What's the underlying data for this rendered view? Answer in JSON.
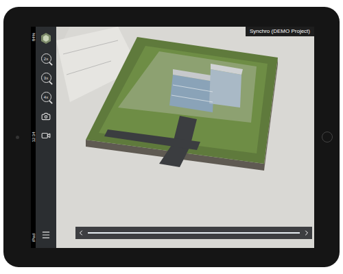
{
  "title": "Synchro (DEMO Project)",
  "status_bar": {
    "battery": "84%",
    "time": "12:34",
    "device": "iPad"
  },
  "toolbar": {
    "zoom_buttons": [
      {
        "label": "2x"
      },
      {
        "label": "3x"
      },
      {
        "label": "4x"
      }
    ]
  },
  "timeline": {
    "level": 1
  }
}
